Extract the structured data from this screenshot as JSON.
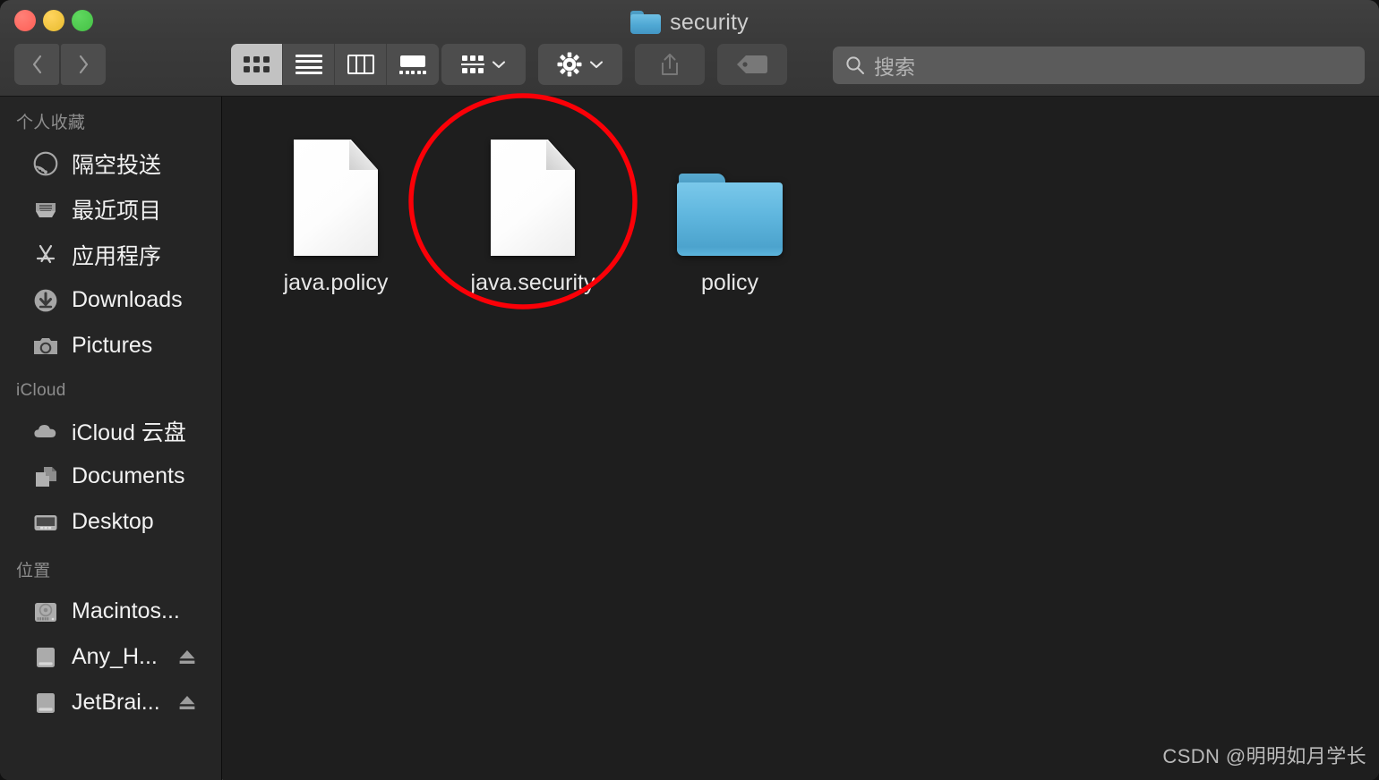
{
  "window": {
    "title": "security",
    "title_icon": "folder-icon",
    "traffic_lights": [
      {
        "name": "close-button",
        "color": "#ff5f56"
      },
      {
        "name": "minimize-button",
        "color": "#e8bb2e"
      },
      {
        "name": "maximize-button",
        "color": "#45c145"
      }
    ]
  },
  "toolbar": {
    "back_label": "back-chevron-icon",
    "forward_label": "forward-chevron-icon",
    "view_modes": [
      {
        "name": "icon-view",
        "icon": "grid-icon",
        "selected": true
      },
      {
        "name": "list-view",
        "icon": "lines-icon",
        "selected": false
      },
      {
        "name": "column-view",
        "icon": "columns-icon",
        "selected": false
      },
      {
        "name": "gallery-view",
        "icon": "gallery-icon",
        "selected": false
      }
    ],
    "group_button": {
      "name": "group-by-button",
      "icon": "grid-small-icon",
      "caret": "chevron-down-icon"
    },
    "action_button": {
      "name": "action-button",
      "icon": "gear-icon",
      "caret": "chevron-down-icon"
    },
    "share_button": {
      "name": "share-button",
      "icon": "share-icon",
      "enabled": false
    },
    "tag_button": {
      "name": "tag-button",
      "icon": "tag-icon",
      "enabled": false
    }
  },
  "search": {
    "placeholder": "搜索",
    "value": "",
    "icon": "search-icon"
  },
  "sidebar": {
    "groups": [
      {
        "title": "个人收藏",
        "items": [
          {
            "label": "隔空投送",
            "icon": "airdrop-icon",
            "eject": false
          },
          {
            "label": "最近项目",
            "icon": "recents-icon",
            "eject": false
          },
          {
            "label": "应用程序",
            "icon": "applications-icon",
            "eject": false
          },
          {
            "label": "Downloads",
            "icon": "downloads-icon",
            "eject": false
          },
          {
            "label": "Pictures",
            "icon": "pictures-icon",
            "eject": false
          }
        ]
      },
      {
        "title": "iCloud",
        "items": [
          {
            "label": "iCloud 云盘",
            "icon": "cloud-icon",
            "eject": false
          },
          {
            "label": "Documents",
            "icon": "documents-icon",
            "eject": false
          },
          {
            "label": "Desktop",
            "icon": "desktop-icon",
            "eject": false
          }
        ]
      },
      {
        "title": "位置",
        "items": [
          {
            "label": "Macintos...",
            "icon": "harddisk-icon",
            "eject": false
          },
          {
            "label": "Any_H...",
            "icon": "external-drive-icon",
            "eject": true
          },
          {
            "label": "JetBrai...",
            "icon": "external-drive-icon",
            "eject": true
          }
        ]
      }
    ]
  },
  "files": [
    {
      "name": "java.policy",
      "type": "document",
      "selected": false,
      "annotated": false
    },
    {
      "name": "java.security",
      "type": "document",
      "selected": false,
      "annotated": true
    },
    {
      "name": "policy",
      "type": "folder",
      "selected": false,
      "annotated": false
    }
  ],
  "annotation": {
    "shape": "ellipse",
    "color": "#fb0007",
    "stroke_width": 5,
    "target": "java.security"
  },
  "watermark": {
    "text": "CSDN @明明如月学长"
  },
  "colors": {
    "toolbar_bg": "#3a3a3a",
    "sidebar_bg": "#252525",
    "content_bg": "#1e1e1e",
    "accent_folder": "#5fb6de",
    "annotation_red": "#fb0007"
  }
}
